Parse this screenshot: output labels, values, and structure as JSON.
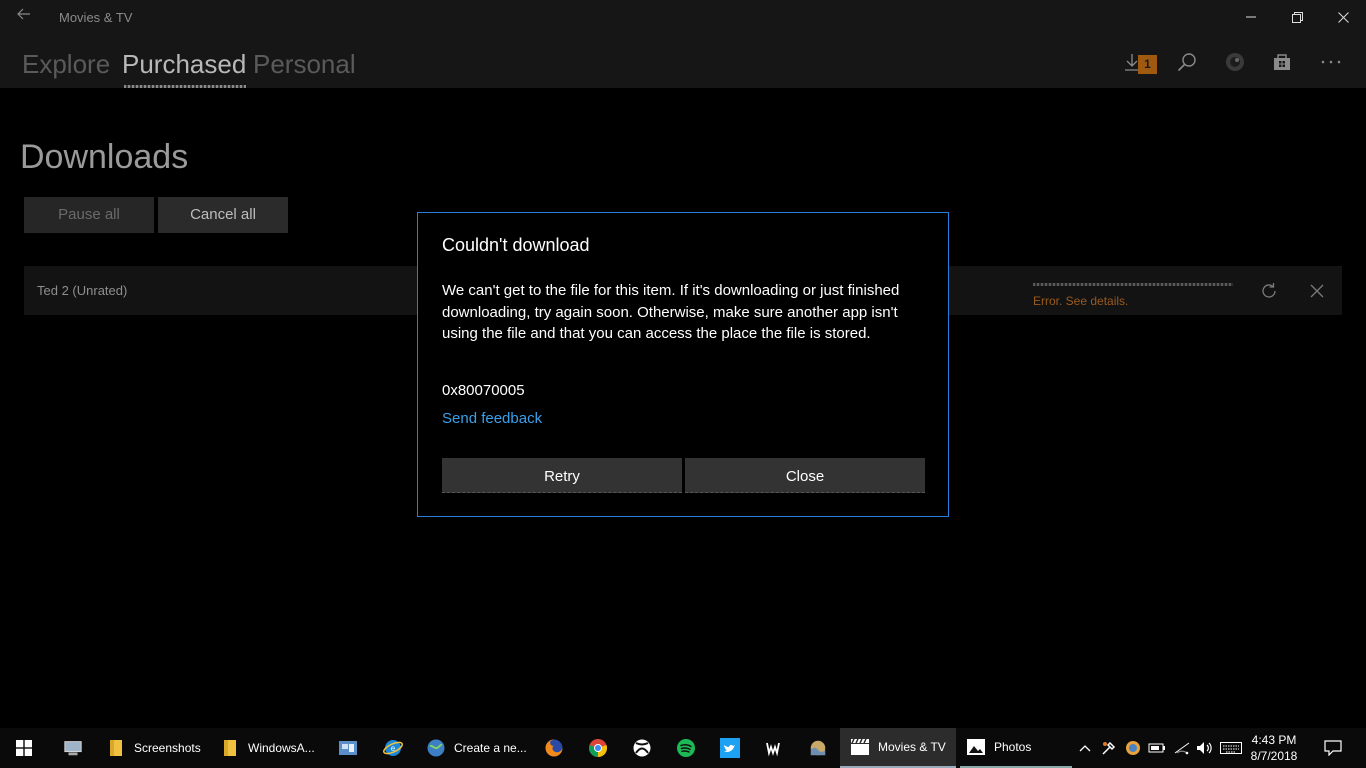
{
  "window": {
    "title": "Movies & TV"
  },
  "nav": {
    "tabs": [
      {
        "label": "Explore"
      },
      {
        "label": "Purchased"
      },
      {
        "label": "Personal"
      }
    ],
    "download_count": "1"
  },
  "page": {
    "title": "Downloads",
    "pause_all": "Pause all",
    "cancel_all": "Cancel all"
  },
  "download": {
    "name": "Ted 2 (Unrated)",
    "error": "Error. See details."
  },
  "dialog": {
    "title": "Couldn't download",
    "message": "We can't get to the file for this item. If it's downloading or just finished downloading, try again soon. Otherwise, make sure another app isn't using the file and that you can access the place the file is stored.",
    "code": "0x80070005",
    "link": "Send feedback",
    "retry": "Retry",
    "close": "Close"
  },
  "taskbar": {
    "items": [
      {
        "label": "Screenshots"
      },
      {
        "label": "WindowsA..."
      },
      {
        "label": "Create a ne..."
      },
      {
        "label": "Movies & TV"
      },
      {
        "label": "Photos"
      }
    ],
    "time": "4:43 PM",
    "date": "8/7/2018"
  },
  "colors": {
    "accent": "#2a7dd6",
    "link": "#3aa0ea",
    "error": "#9a5a1e",
    "badge": "#a05a10"
  }
}
